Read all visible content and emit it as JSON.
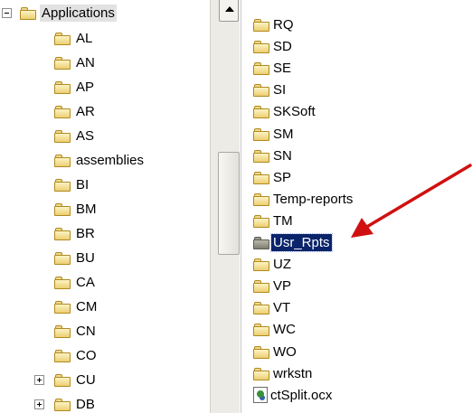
{
  "left_tree": {
    "root": {
      "label": "Applications",
      "expander": "minus"
    },
    "items": [
      {
        "label": "AL",
        "expander": ""
      },
      {
        "label": "AN",
        "expander": ""
      },
      {
        "label": "AP",
        "expander": ""
      },
      {
        "label": "AR",
        "expander": ""
      },
      {
        "label": "AS",
        "expander": ""
      },
      {
        "label": "assemblies",
        "expander": ""
      },
      {
        "label": "BI",
        "expander": ""
      },
      {
        "label": "BM",
        "expander": ""
      },
      {
        "label": "BR",
        "expander": ""
      },
      {
        "label": "BU",
        "expander": ""
      },
      {
        "label": "CA",
        "expander": ""
      },
      {
        "label": "CM",
        "expander": ""
      },
      {
        "label": "CN",
        "expander": ""
      },
      {
        "label": "CO",
        "expander": ""
      },
      {
        "label": "CU",
        "expander": "plus"
      },
      {
        "label": "DB",
        "expander": "plus"
      }
    ]
  },
  "right_list": {
    "items": [
      {
        "label": "RQ",
        "type": "folder"
      },
      {
        "label": "SD",
        "type": "folder"
      },
      {
        "label": "SE",
        "type": "folder"
      },
      {
        "label": "SI",
        "type": "folder"
      },
      {
        "label": "SKSoft",
        "type": "folder"
      },
      {
        "label": "SM",
        "type": "folder"
      },
      {
        "label": "SN",
        "type": "folder"
      },
      {
        "label": "SP",
        "type": "folder"
      },
      {
        "label": "Temp-reports",
        "type": "folder"
      },
      {
        "label": "TM",
        "type": "folder"
      },
      {
        "label": "Usr_Rpts",
        "type": "folder",
        "selected": true
      },
      {
        "label": "UZ",
        "type": "folder"
      },
      {
        "label": "VP",
        "type": "folder"
      },
      {
        "label": "VT",
        "type": "folder"
      },
      {
        "label": "WC",
        "type": "folder"
      },
      {
        "label": "WO",
        "type": "folder"
      },
      {
        "label": "wrkstn",
        "type": "folder"
      },
      {
        "label": "ctSplit.ocx",
        "type": "file"
      }
    ]
  },
  "annotation": {
    "type": "arrow",
    "color": "#d01010",
    "points_to": "Usr_Rpts"
  },
  "colors": {
    "selection": "#0a246a",
    "selection_text": "#ffffff",
    "folder": "#f3dc8a"
  }
}
